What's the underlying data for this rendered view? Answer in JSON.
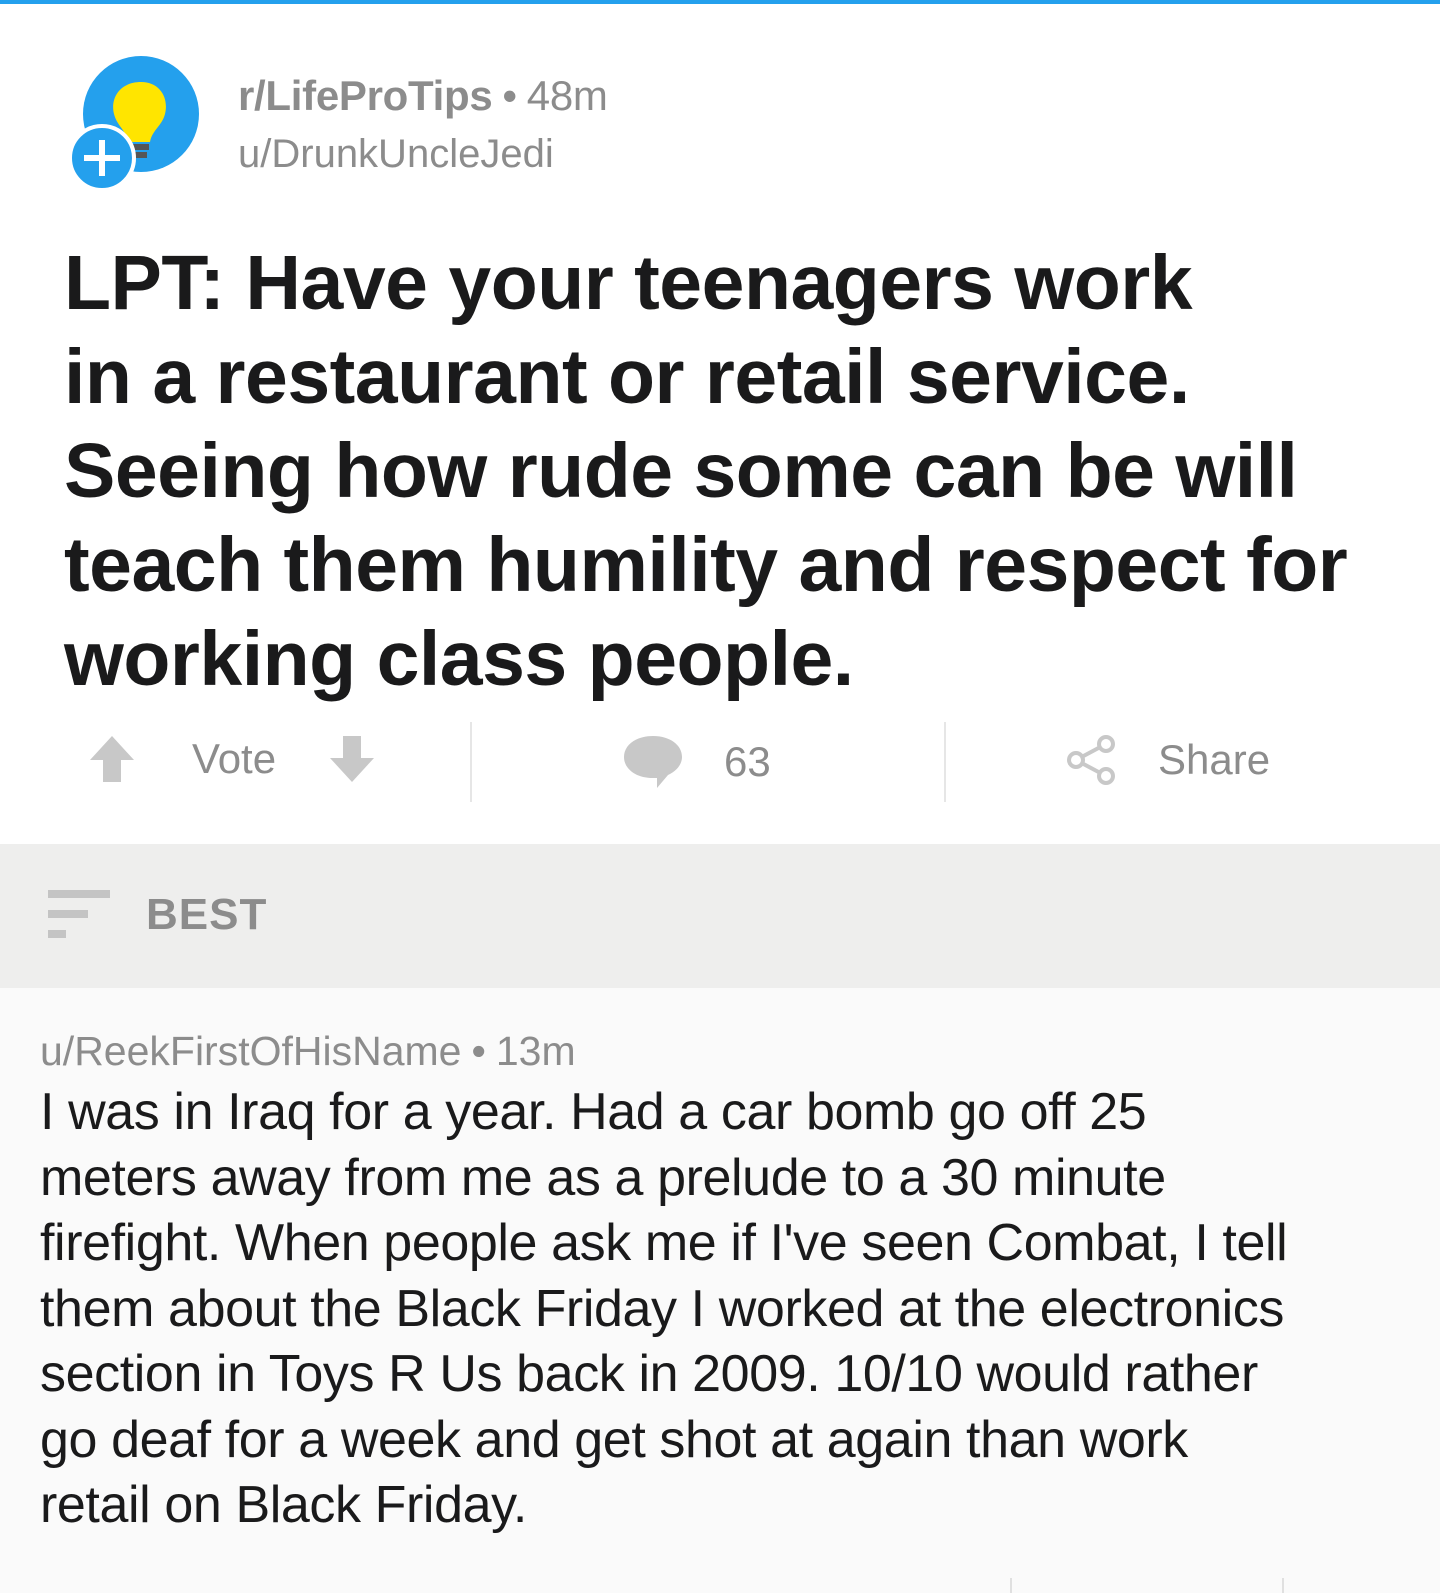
{
  "post": {
    "subreddit": "r/LifeProTips",
    "separator": "•",
    "age": "48m",
    "author": "u/DrunkUncleJedi",
    "title_lines": [
      "LPT: Have your teenagers work",
      "in a restaurant or retail service.",
      "Seeing how rude some can be will",
      "teach them humility and respect for",
      "working class people."
    ],
    "actions": {
      "vote_label": "Vote",
      "comment_count": "63",
      "share_label": "Share"
    },
    "icons": {
      "avatar": "lightbulb-avatar-icon",
      "join": "plus-icon",
      "upvote": "arrow-up-icon",
      "downvote": "arrow-down-icon",
      "comments": "speech-bubble-icon",
      "share": "share-icon"
    },
    "colors": {
      "accent": "#24a0ed",
      "bulb": "#ffe500",
      "muted": "#8c8c8c",
      "text": "#1a1a1b"
    }
  },
  "sort": {
    "label": "BEST",
    "icon": "sort-icon"
  },
  "comment": {
    "author": "u/ReekFirstOfHisName",
    "separator": "•",
    "age": "13m",
    "body_lines": [
      "I was in Iraq for a year. Had a car bomb go off 25",
      "meters away from me as a prelude to a 30 minute",
      "firefight. When people ask me if I've seen Combat, I tell",
      "them about the Black Friday I worked at the electronics",
      "section in Toys R Us back in 2009. 10/10 would rather",
      "go deaf for a week and get shot at again than work",
      "retail on Black Friday."
    ]
  }
}
